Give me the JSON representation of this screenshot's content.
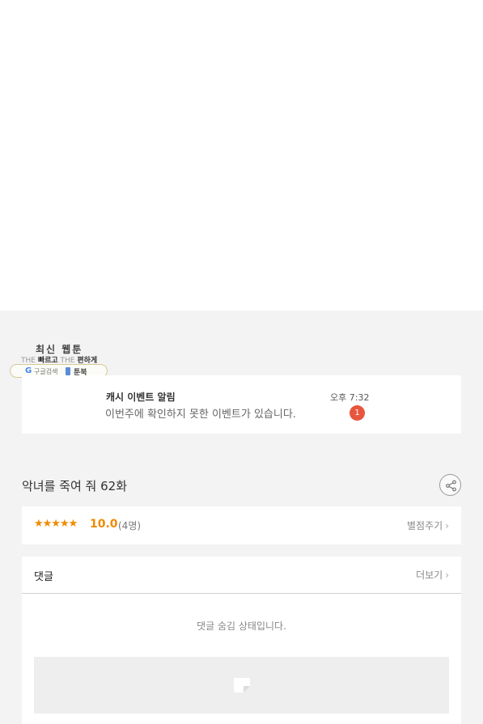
{
  "logo": {
    "title": "최신 웹툰",
    "sub_the1": "THE",
    "sub_fast": "빠르고",
    "sub_the2": "THE",
    "sub_easy": "편하게",
    "search_label": "구글검색",
    "book_label": "툰북"
  },
  "notification": {
    "title": "캐시 이벤트 알림",
    "message": "이번주에 확인하지 못한 이벤트가 있습니다.",
    "time": "오후 7:32",
    "badge_count": "1"
  },
  "episode": {
    "title": "악녀를 죽여 줘 62화"
  },
  "rating": {
    "stars": "★★★★★",
    "score": "10.0",
    "count": "(4명)",
    "rate_button": "별점주기"
  },
  "comments": {
    "title": "댓글",
    "more_button": "더보기",
    "hidden_message": "댓글 숨김 상태입니다."
  },
  "icons": {
    "share": "share-icon",
    "chevron": "chevron-right-icon",
    "google": "google-icon",
    "book": "book-icon",
    "image_placeholder": "image-placeholder-icon"
  },
  "colors": {
    "accent_orange": "#f08a00",
    "badge_red": "#e8553e",
    "background_gray": "#f3f3f3"
  }
}
